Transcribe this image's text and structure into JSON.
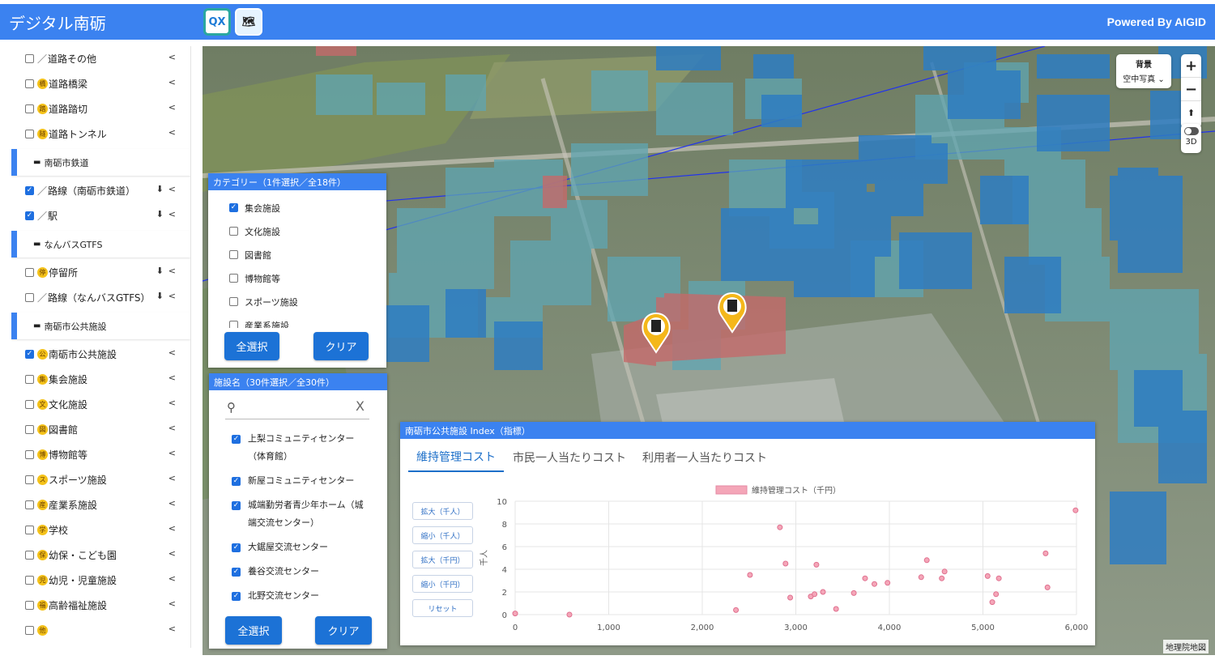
{
  "header": {
    "title": "デジタル南砺",
    "powered": "Powered By AIGID",
    "icon_a_text": "QX",
    "icon_b_text": "🗺"
  },
  "sidebar": {
    "rows": [
      {
        "type": "layer",
        "checked": false,
        "icon": "／",
        "label": "道路その他",
        "download": false
      },
      {
        "type": "layer",
        "checked": false,
        "icon": "橋",
        "label": "道路橋梁",
        "download": false
      },
      {
        "type": "layer",
        "checked": false,
        "icon": "踏",
        "label": "道路踏切",
        "download": false
      },
      {
        "type": "layer",
        "checked": false,
        "icon": "隧",
        "label": "道路トンネル",
        "download": false
      },
      {
        "type": "group",
        "label": "南砺市鉄道"
      },
      {
        "type": "layer",
        "checked": true,
        "icon": "／",
        "label": "路線（南砺市鉄道）",
        "download": true
      },
      {
        "type": "layer",
        "checked": true,
        "icon": "／",
        "label": "駅",
        "download": true
      },
      {
        "type": "group",
        "label": "なんバスGTFS"
      },
      {
        "type": "layer",
        "checked": false,
        "icon": "停",
        "label": "停留所",
        "download": true
      },
      {
        "type": "layer",
        "checked": false,
        "icon": "／",
        "label": "路線（なんバスGTFS）",
        "download": true
      },
      {
        "type": "group",
        "label": "南砺市公共施設"
      },
      {
        "type": "layer",
        "checked": true,
        "icon": "公",
        "label": "南砺市公共施設",
        "download": false
      },
      {
        "type": "layer",
        "checked": false,
        "icon": "集",
        "label": "集会施設",
        "download": false
      },
      {
        "type": "layer",
        "checked": false,
        "icon": "文",
        "label": "文化施設",
        "download": false
      },
      {
        "type": "layer",
        "checked": false,
        "icon": "図",
        "label": "図書館",
        "download": false
      },
      {
        "type": "layer",
        "checked": false,
        "icon": "博",
        "label": "博物館等",
        "download": false
      },
      {
        "type": "layer",
        "checked": false,
        "icon": "ス",
        "label": "スポーツ施設",
        "download": false
      },
      {
        "type": "layer",
        "checked": false,
        "icon": "産",
        "label": "産業系施設",
        "download": false
      },
      {
        "type": "layer",
        "checked": false,
        "icon": "学",
        "label": "学校",
        "download": false
      },
      {
        "type": "layer",
        "checked": false,
        "icon": "保",
        "label": "幼保・こども園",
        "download": false
      },
      {
        "type": "layer",
        "checked": false,
        "icon": "児",
        "label": "幼児・児童施設",
        "download": false
      },
      {
        "type": "layer",
        "checked": false,
        "icon": "福",
        "label": "高齢福祉施設",
        "download": false
      },
      {
        "type": "layer",
        "checked": false,
        "icon": "他",
        "label": "",
        "download": false
      }
    ],
    "download_glyph": "⬇",
    "share_glyph": "<"
  },
  "map": {
    "background_title": "背景",
    "background_value": "空中写真",
    "zoom_in": "+",
    "zoom_out": "−",
    "compass": "⬆",
    "mode_3d": "3D",
    "attribution": "地理院地図"
  },
  "category_panel": {
    "title": "カテゴリー（1件選択／全18件）",
    "options": [
      {
        "label": "集会施設",
        "checked": true
      },
      {
        "label": "文化施設",
        "checked": false
      },
      {
        "label": "図書館",
        "checked": false
      },
      {
        "label": "博物館等",
        "checked": false
      },
      {
        "label": "スポーツ施設",
        "checked": false
      },
      {
        "label": "産業系施設",
        "checked": false
      }
    ],
    "select_all": "全選択",
    "clear": "クリア"
  },
  "facility_panel": {
    "title": "施設名（30件選択／全30件）",
    "search_placeholder": "",
    "search_clear": "X",
    "items": [
      {
        "label": "上梨コミュニティセンター（体育館）",
        "checked": true
      },
      {
        "label": "新屋コミュニティセンター",
        "checked": true
      },
      {
        "label": "城端勤労者青少年ホーム（城端交流センター）",
        "checked": true
      },
      {
        "label": "大鋸屋交流センター",
        "checked": true
      },
      {
        "label": "養谷交流センター",
        "checked": true
      },
      {
        "label": "北野交流センター",
        "checked": true
      }
    ],
    "select_all": "全選択",
    "clear": "クリア"
  },
  "index_panel": {
    "title": "南砺市公共施設 Index（指標）",
    "tabs": [
      "維持管理コスト",
      "市民一人当たりコスト",
      "利用者一人当たりコスト"
    ],
    "active_tab": 0,
    "zoom_buttons": [
      "拡大（千人）",
      "縮小（千人）",
      "拡大（千円）",
      "縮小（千円）",
      "リセット"
    ]
  },
  "chart_data": {
    "type": "scatter",
    "series": [
      {
        "name": "維持管理コスト（千円）",
        "color": "#f4a6b8",
        "points": [
          [
            0,
            0.1
          ],
          [
            580,
            0
          ],
          [
            2360,
            0.4
          ],
          [
            2510,
            3.5
          ],
          [
            2830,
            7.7
          ],
          [
            2890,
            4.5
          ],
          [
            2940,
            1.5
          ],
          [
            3160,
            1.6
          ],
          [
            3200,
            1.8
          ],
          [
            3220,
            4.4
          ],
          [
            3290,
            2.0
          ],
          [
            3430,
            0.5
          ],
          [
            3620,
            1.9
          ],
          [
            3740,
            3.2
          ],
          [
            3840,
            2.7
          ],
          [
            3980,
            2.8
          ],
          [
            4340,
            3.3
          ],
          [
            4400,
            4.8
          ],
          [
            4560,
            3.2
          ],
          [
            4590,
            3.8
          ],
          [
            5050,
            3.4
          ],
          [
            5100,
            1.1
          ],
          [
            5140,
            1.8
          ],
          [
            5170,
            3.2
          ],
          [
            5670,
            5.4
          ],
          [
            5690,
            2.4
          ],
          [
            5990,
            9.2
          ]
        ]
      }
    ],
    "xlabel": "",
    "ylabel": "千人",
    "xlim": [
      0,
      6000
    ],
    "ylim": [
      0,
      10
    ],
    "xticks": [
      "0",
      "1,000",
      "2,000",
      "3,000",
      "4,000",
      "5,000",
      "6,000"
    ],
    "yticks": [
      "0",
      "2",
      "4",
      "6",
      "8",
      "10"
    ],
    "legend": "top",
    "grid": true
  }
}
